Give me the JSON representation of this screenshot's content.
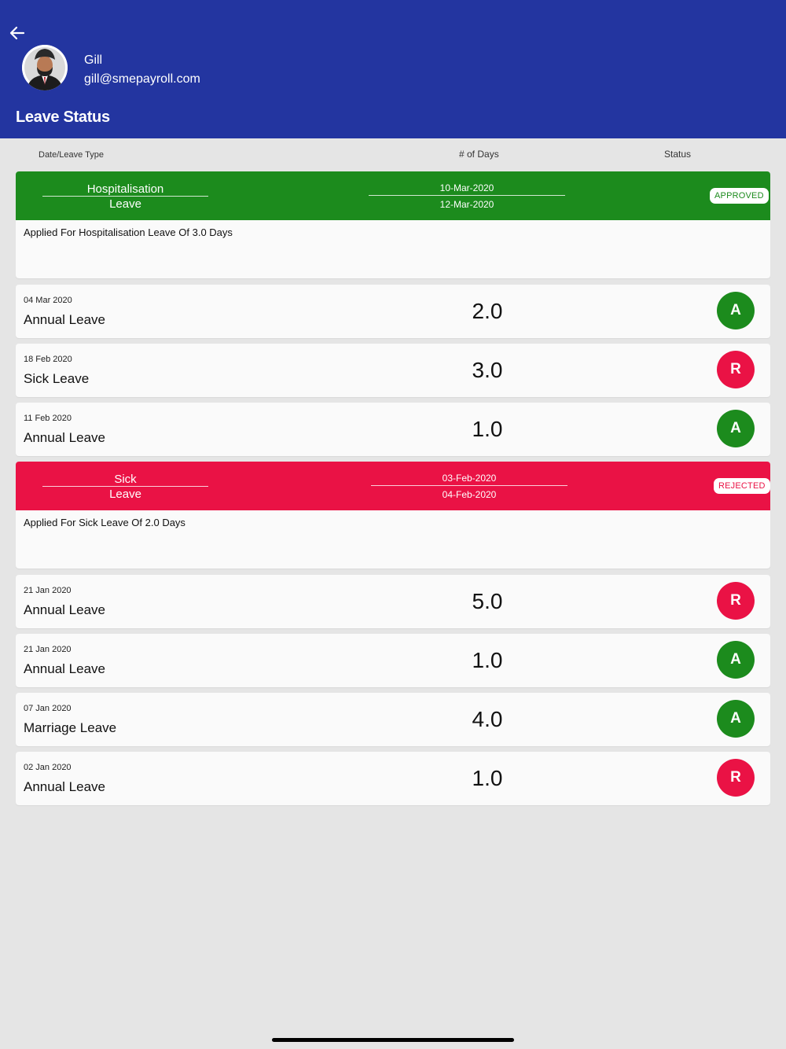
{
  "header": {
    "user_name": "Gill",
    "user_email": "gill@smepayroll.com",
    "title": "Leave Status",
    "back_icon": "arrow-left-icon",
    "background_color": "#2335a0"
  },
  "columns": {
    "date_type": "Date/Leave Type",
    "days": "# of Days",
    "status": "Status"
  },
  "expanded": [
    {
      "type_line1": "Hospitalisation",
      "type_line2": "Leave",
      "from_date": "10-Mar-2020",
      "to_date": "12-Mar-2020",
      "badge": "APPROVED",
      "description": "Applied For Hospitalisation Leave Of 3.0 Days",
      "color": "#1c8b1d"
    },
    {
      "type_line1": "Sick",
      "type_line2": "Leave",
      "from_date": "03-Feb-2020",
      "to_date": "04-Feb-2020",
      "badge": "REJECTED",
      "description": "Applied For Sick Leave Of 2.0 Days",
      "color": "#ea1245"
    }
  ],
  "rows": [
    {
      "date": "04 Mar 2020",
      "type": "Annual Leave",
      "days": "2.0",
      "status": "A"
    },
    {
      "date": "18 Feb 2020",
      "type": "Sick Leave",
      "days": "3.0",
      "status": "R"
    },
    {
      "date": "11 Feb 2020",
      "type": "Annual Leave",
      "days": "1.0",
      "status": "A"
    },
    {
      "date": "21 Jan 2020",
      "type": "Annual Leave",
      "days": "5.0",
      "status": "R"
    },
    {
      "date": "21 Jan 2020",
      "type": "Annual Leave",
      "days": "1.0",
      "status": "A"
    },
    {
      "date": "07 Jan 2020",
      "type": "Marriage Leave",
      "days": "4.0",
      "status": "A"
    },
    {
      "date": "02 Jan 2020",
      "type": "Annual Leave",
      "days": "1.0",
      "status": "R"
    }
  ],
  "status_colors": {
    "approved": "#1c8b1d",
    "rejected": "#ea1245"
  }
}
